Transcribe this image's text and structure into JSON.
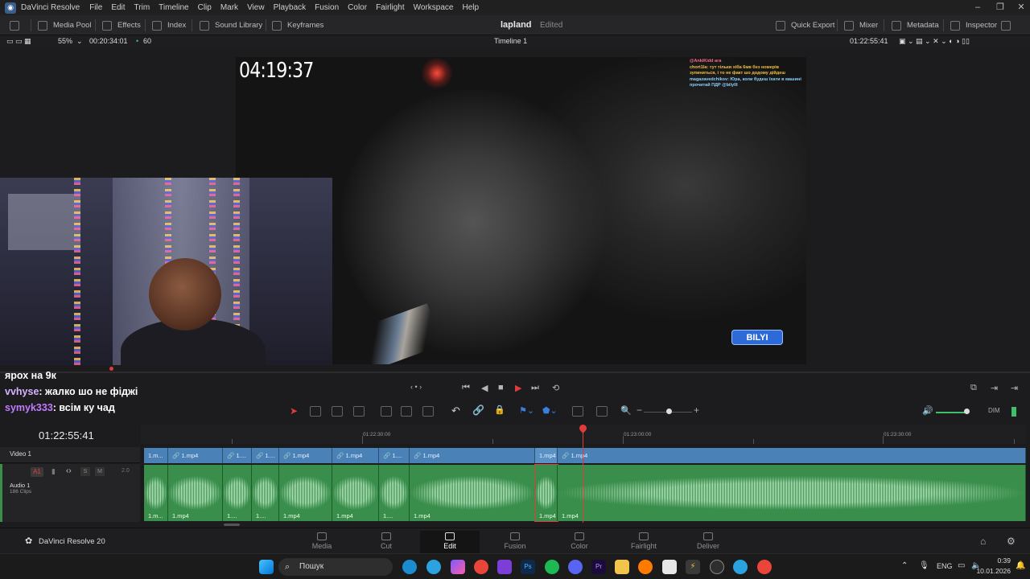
{
  "titlebar": {
    "app_name": "DaVinci Resolve",
    "menu": [
      "File",
      "Edit",
      "Trim",
      "Timeline",
      "Clip",
      "Mark",
      "View",
      "Playback",
      "Fusion",
      "Color",
      "Fairlight",
      "Workspace",
      "Help"
    ]
  },
  "toolbar": {
    "media_pool": "Media Pool",
    "effects": "Effects",
    "index": "Index",
    "sound_library": "Sound Library",
    "keyframes": "Keyframes",
    "project_name": "lapland",
    "project_state": "Edited",
    "quick_export": "Quick Export",
    "mixer": "Mixer",
    "metadata": "Metadata",
    "inspector": "Inspector"
  },
  "viewerbar": {
    "zoom": "55%",
    "source_timecode": "00:20:34:01",
    "fps": "60",
    "timeline_name": "Timeline 1",
    "record_timecode": "01:22:55:41"
  },
  "video": {
    "timer": "04:19:37",
    "chat_lines": [
      {
        "user": "@AnkiKidd ага",
        "cls": "u1"
      },
      {
        "user": "chort1la: тут тільки хіба 6мв без номерів зупиниться, і то не факт шо додому дійдеш",
        "cls": "u2"
      },
      {
        "user": "magazavedchikov: Юра, коли будеш їхати в машині прочитай ПДР @bilylll",
        "cls": "u3"
      }
    ],
    "badge": "BILYI"
  },
  "stream_chat": [
    {
      "name": "",
      "text": "ярох на 9к"
    },
    {
      "name": "vvhyse",
      "text": ": жалко шо не фіджі"
    },
    {
      "name": "symyk333",
      "text": ": всім ку чад"
    }
  ],
  "timeline": {
    "current_timecode": "01:22:55:41",
    "ruler_labels": [
      "01:22:30:00",
      "01:23:00:00",
      "01:23:30:00"
    ],
    "video_track": {
      "name": "Video 1"
    },
    "audio_track": {
      "name": "Audio 1",
      "tag": "A1",
      "clips_count": "186 Clips",
      "level": "2.0",
      "solo": "S",
      "mute": "M"
    },
    "clip_label": "1.mp4",
    "clip_label_short": "1.m...",
    "clip_label_tiny": "1...."
  },
  "pagenav": {
    "brand": "DaVinci Resolve 20",
    "pages": [
      "Media",
      "Cut",
      "Edit",
      "Fusion",
      "Color",
      "Fairlight",
      "Deliver"
    ],
    "active": "Edit"
  },
  "taskbar": {
    "search_placeholder": "Пошук",
    "lang": "ENG",
    "time": "0:39",
    "date": "10.01.2026"
  },
  "colors": {
    "video_clip": "#4a82b8",
    "audio_clip": "#3a8e4c",
    "playhead": "#e23b3b"
  }
}
